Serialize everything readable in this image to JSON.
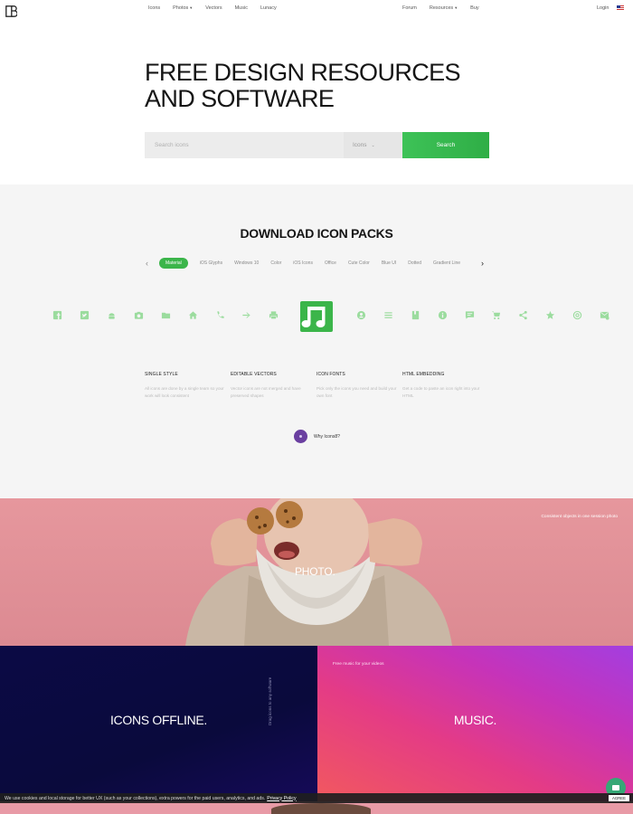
{
  "nav": {
    "left_items": [
      {
        "label": "Icons",
        "dropdown": false
      },
      {
        "label": "Photos",
        "dropdown": true
      },
      {
        "label": "Vectors",
        "dropdown": false
      },
      {
        "label": "Music",
        "dropdown": false
      },
      {
        "label": "Lunacy",
        "dropdown": false
      }
    ],
    "right_items": [
      {
        "label": "Forum",
        "dropdown": false
      },
      {
        "label": "Resources",
        "dropdown": true
      },
      {
        "label": "Buy",
        "dropdown": false
      }
    ],
    "login": "Login"
  },
  "hero": {
    "title_line1": "FREE DESIGN RESOURCES",
    "title_line2": "AND SOFTWARE",
    "search_placeholder": "Search icons",
    "search_type": "Icons",
    "search_button": "Search"
  },
  "packs": {
    "title": "DOWNLOAD ICON PACKS",
    "tabs": [
      "Material",
      "iOS Glyphs",
      "Windows 10",
      "Color",
      "iOS Icons",
      "Office",
      "Cute Color",
      "Blue UI",
      "Dotted",
      "Gradient Line"
    ],
    "active_tab": "Material",
    "icons_left": [
      "facebook-icon",
      "twitter-icon",
      "android-icon",
      "camera-icon",
      "folder-icon",
      "home-icon",
      "phone-icon",
      "arrow-right-icon",
      "printer-icon"
    ],
    "icons_right": [
      "account-icon",
      "menu-icon",
      "book-icon",
      "info-icon",
      "chat-icon",
      "cart-icon",
      "share-icon",
      "star-icon",
      "at-icon",
      "mail-check-icon"
    ],
    "features": [
      {
        "title": "SINGLE STYLE",
        "text": "All icons are done by a single team so your work will look consistent"
      },
      {
        "title": "EDITABLE VECTORS",
        "text": "Vector icons are not merged and have preserved shapes"
      },
      {
        "title": "ICON FONTS",
        "text": "Pick only the icons you need and build your own font"
      },
      {
        "title": "HTML EMBEDDING",
        "text": "Get a code to paste an icon right into your HTML"
      }
    ],
    "why_label": "Why Icons8?",
    "accent_color": "#3bb54a"
  },
  "photo": {
    "label": "PHOTO.",
    "caption": "Consistent objects in one session photo"
  },
  "offline": {
    "title": "ICONS OFFLINE.",
    "side_text": "Drag icons to any software"
  },
  "music": {
    "title": "MUSIC.",
    "caption": "Free music for your videos"
  },
  "cookie": {
    "text": "We use cookies and local storage for better UX (such as your collections), extra powers for the paid users, analytics, and ads.",
    "link": "Privacy Policy",
    "agree": "AGREE"
  }
}
